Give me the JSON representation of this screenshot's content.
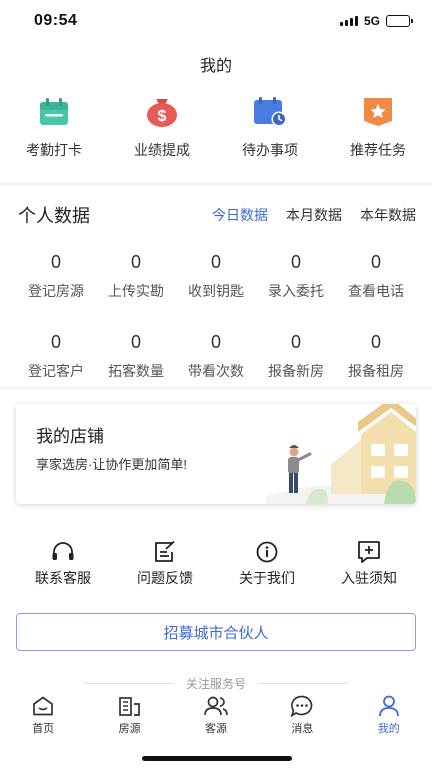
{
  "status_bar": {
    "time": "09:54",
    "network": "5G",
    "battery_level": 0.85
  },
  "page": {
    "title": "我的"
  },
  "quick_actions": [
    {
      "label": "考勤打卡",
      "icon": "calendar-icon",
      "color": "#46c8a8"
    },
    {
      "label": "业绩提成",
      "icon": "money-bag-icon",
      "color": "#e85a55"
    },
    {
      "label": "待办事项",
      "icon": "todo-clock-icon",
      "color": "#4a7be0"
    },
    {
      "label": "推荐任务",
      "icon": "star-ribbon-icon",
      "color": "#f08a45"
    }
  ],
  "personal_data": {
    "title": "个人数据",
    "tabs": [
      {
        "label": "今日数据",
        "active": true
      },
      {
        "label": "本月数据",
        "active": false
      },
      {
        "label": "本年数据",
        "active": false
      }
    ],
    "rows": [
      [
        {
          "value": "0",
          "label": "登记房源"
        },
        {
          "value": "0",
          "label": "上传实勘"
        },
        {
          "value": "0",
          "label": "收到钥匙"
        },
        {
          "value": "0",
          "label": "录入委托"
        },
        {
          "value": "0",
          "label": "查看电话"
        }
      ],
      [
        {
          "value": "0",
          "label": "登记客户"
        },
        {
          "value": "0",
          "label": "拓客数量"
        },
        {
          "value": "0",
          "label": "带看次数"
        },
        {
          "value": "0",
          "label": "报备新房"
        },
        {
          "value": "0",
          "label": "报备租房"
        }
      ]
    ]
  },
  "shop": {
    "title": "我的店铺",
    "subtitle": "享家选房·让协作更加简单!"
  },
  "services": [
    {
      "label": "联系客服",
      "icon": "headset-icon"
    },
    {
      "label": "问题反馈",
      "icon": "feedback-icon"
    },
    {
      "label": "关于我们",
      "icon": "info-icon"
    },
    {
      "label": "入驻须知",
      "icon": "add-notice-icon"
    }
  ],
  "recruit_button": "招募城市合伙人",
  "follow_text": "关注服务号",
  "tabbar": [
    {
      "label": "首页",
      "icon": "home-icon",
      "active": false
    },
    {
      "label": "房源",
      "icon": "building-icon",
      "active": false
    },
    {
      "label": "客源",
      "icon": "users-icon",
      "active": false
    },
    {
      "label": "消息",
      "icon": "chat-icon",
      "active": false
    },
    {
      "label": "我的",
      "icon": "person-icon",
      "active": true
    }
  ],
  "colors": {
    "accent": "#3d6ad6",
    "text": "#222222",
    "muted": "#999999"
  }
}
